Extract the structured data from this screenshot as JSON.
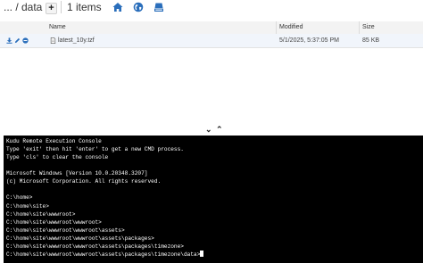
{
  "breadcrumb": {
    "path": "... / data",
    "count": "1 items"
  },
  "toolbar": {
    "add_icon": "plus-icon",
    "home_icon": "home-icon",
    "globe_icon": "globe-icon",
    "drive_icon": "drive-icon"
  },
  "table": {
    "columns": [
      "Name",
      "Modified",
      "Size"
    ],
    "rows": [
      {
        "name": "latest_10y.tzf",
        "modified": "5/1/2025, 5:37:05 PM",
        "size": "85 KB"
      }
    ]
  },
  "colors": {
    "accent": "#2a6ebb",
    "console_bg": "#000000"
  },
  "console": {
    "lines": [
      "Kudu Remote Execution Console",
      "Type 'exit' then hit 'enter' to get a new CMD process.",
      "Type 'cls' to clear the console",
      "",
      "Microsoft Windows [Version 10.0.20348.3207]",
      "(c) Microsoft Corporation. All rights reserved.",
      "",
      "C:\\home>",
      "C:\\home\\site>",
      "C:\\home\\site\\wwwroot>",
      "C:\\home\\site\\wwwroot\\wwwroot>",
      "C:\\home\\site\\wwwroot\\wwwroot\\assets>",
      "C:\\home\\site\\wwwroot\\wwwroot\\assets\\packages>",
      "C:\\home\\site\\wwwroot\\wwwroot\\assets\\packages\\timezone>",
      "C:\\home\\site\\wwwroot\\wwwroot\\assets\\packages\\timezone\\data>"
    ]
  }
}
